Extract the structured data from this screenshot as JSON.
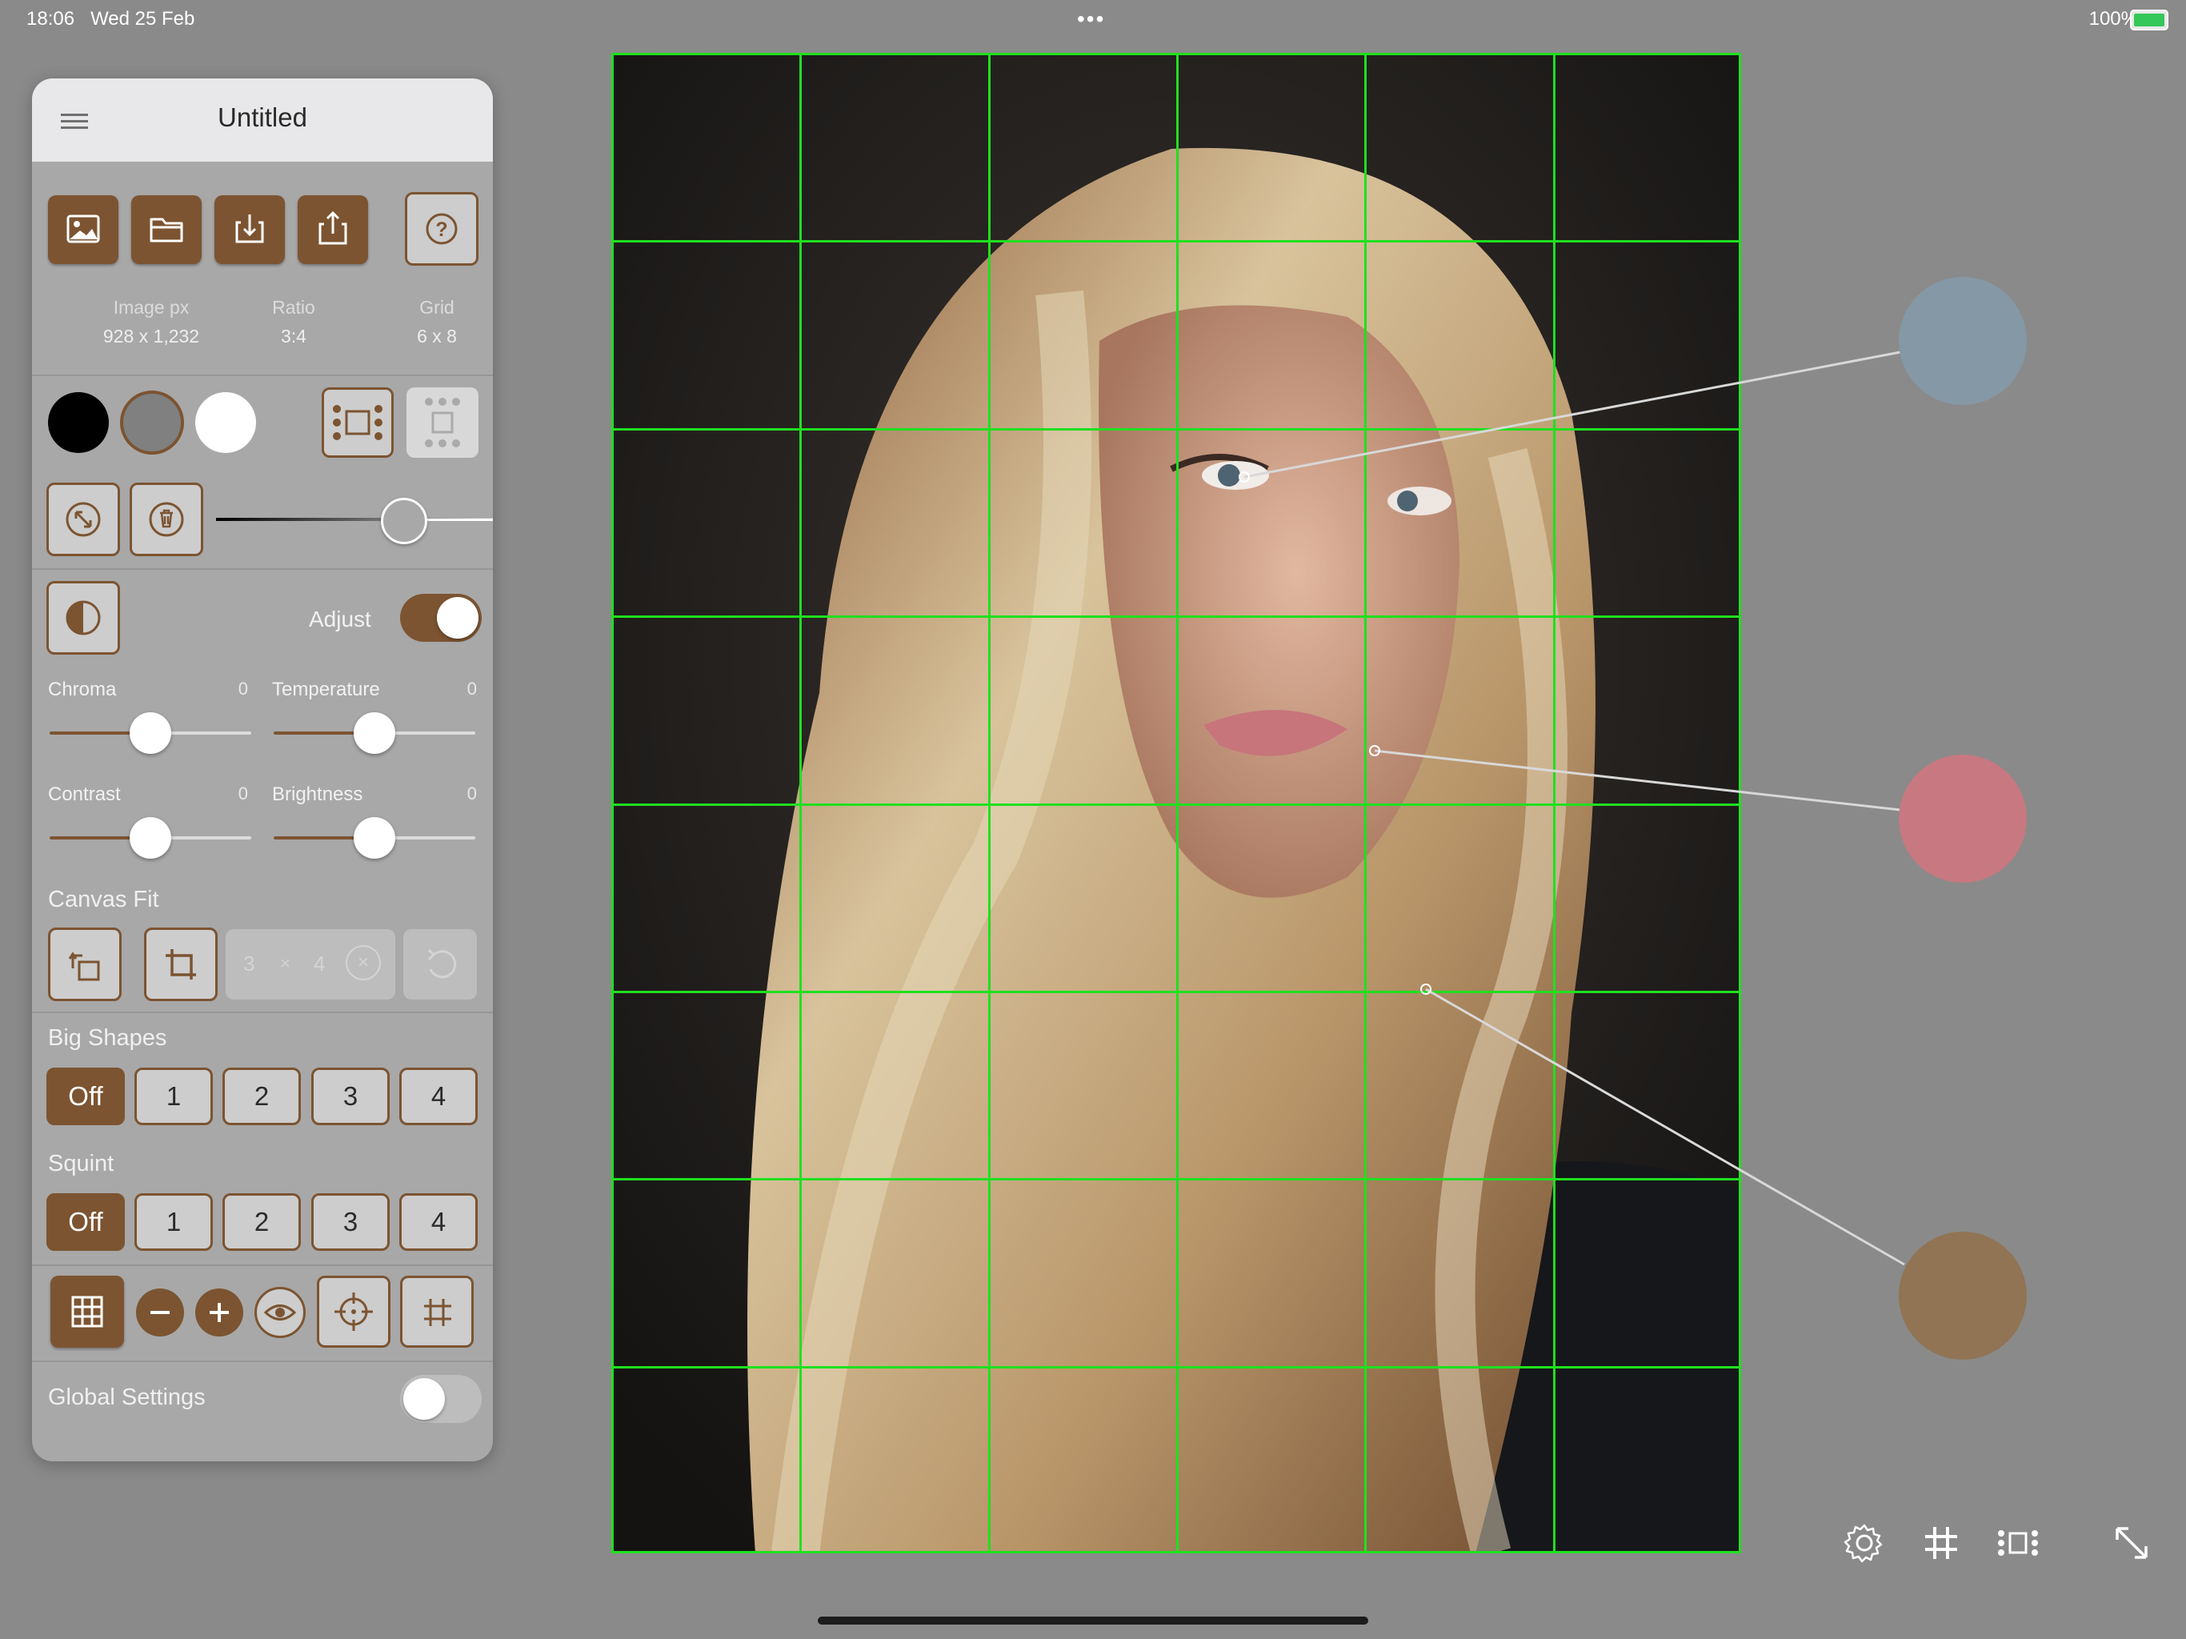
{
  "status_bar": {
    "time": "18:06",
    "date": "Wed 25 Feb",
    "battery": "100%"
  },
  "panel": {
    "title": "Untitled",
    "info": [
      {
        "label": "Image px",
        "value": "928 x 1,232"
      },
      {
        "label": "Ratio",
        "value": "3:4"
      },
      {
        "label": "Grid",
        "value": "6 x 8"
      }
    ],
    "swatches": [
      "#000000",
      "#808080",
      "#ffffff"
    ],
    "opacity_slider": 0.82,
    "adjust": {
      "label": "Adjust",
      "on": true
    },
    "sliders": [
      {
        "label": "Chroma",
        "value": "0",
        "level": 0.5
      },
      {
        "label": "Temperature",
        "value": "0",
        "level": 0.5
      },
      {
        "label": "Contrast",
        "value": "0",
        "level": 0.5
      },
      {
        "label": "Brightness",
        "value": "0",
        "level": 0.5
      }
    ],
    "canvas_fit": {
      "label": "Canvas Fit",
      "w": "3",
      "x": "×",
      "h": "4"
    },
    "big_shapes": {
      "label": "Big Shapes",
      "options": [
        "Off",
        "1",
        "2",
        "3",
        "4"
      ],
      "selected": 0
    },
    "squint": {
      "label": "Squint",
      "options": [
        "Off",
        "1",
        "2",
        "3",
        "4"
      ],
      "selected": 0
    },
    "global_settings": {
      "label": "Global Settings",
      "on": false
    }
  },
  "canvas": {
    "grid_cols": 6,
    "grid_rows": 8,
    "grid_color": "#1fe01f"
  },
  "picked_colors": [
    "#8598a6",
    "#c87880",
    "#907454"
  ],
  "colors": {
    "accent": "#7c5431",
    "background": "#8a8a8a"
  }
}
